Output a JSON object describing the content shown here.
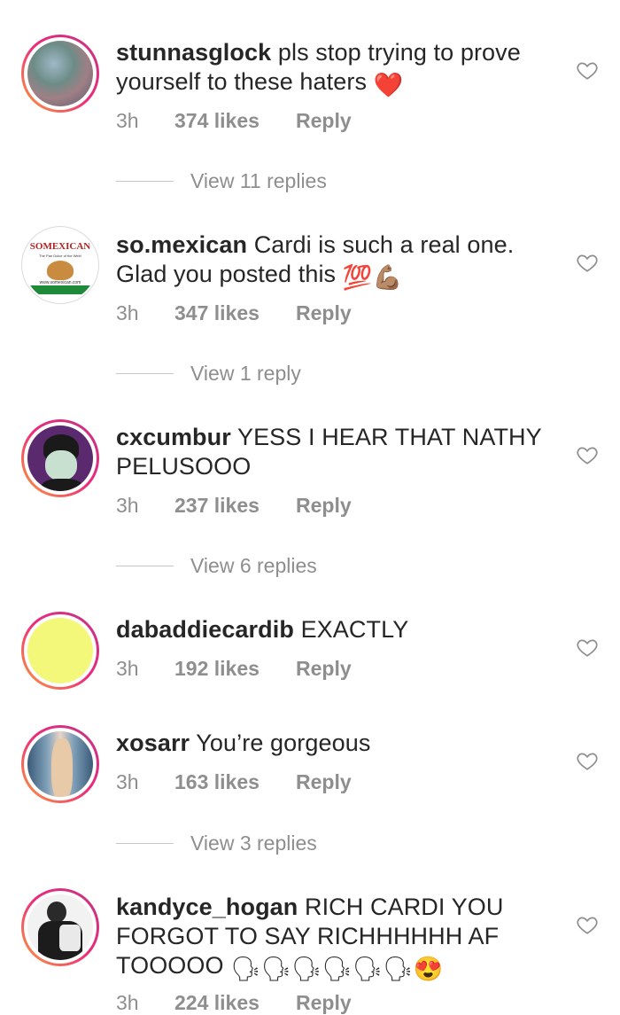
{
  "comments": [
    {
      "username": "stunnasglock",
      "text": "pls stop trying to prove yourself to these haters",
      "emoji": "❤️",
      "time": "3h",
      "likes": "374 likes",
      "reply": "Reply",
      "view_replies": "View 11 replies"
    },
    {
      "username": "so.mexican",
      "text": "Cardi is such a real one. Glad you posted this",
      "emoji": "💯💪🏽",
      "time": "3h",
      "likes": "347 likes",
      "reply": "Reply",
      "view_replies": "View 1 reply",
      "avatar_text": "SOMEXICAN",
      "avatar_sub": "The Pan Dulce of the Web!",
      "avatar_url": "www.somexican.com"
    },
    {
      "username": "cxcumbur",
      "text": "YESS I HEAR THAT NATHY PELUSOOO",
      "time": "3h",
      "likes": "237 likes",
      "reply": "Reply",
      "view_replies": "View 6 replies"
    },
    {
      "username": "dabaddiecardib",
      "text": "EXACTLY",
      "time": "3h",
      "likes": "192 likes",
      "reply": "Reply"
    },
    {
      "username": "xosarr",
      "text": "You’re gorgeous",
      "time": "3h",
      "likes": "163 likes",
      "reply": "Reply",
      "view_replies": "View 3 replies"
    },
    {
      "username": "kandyce_hogan",
      "text": "RICH CARDI YOU FORGOT TO SAY RICHHHHHH AF TOOOOO",
      "emoji": "🗣🗣🗣🗣🗣🗣😍",
      "time": "3h",
      "likes": "224 likes",
      "reply": "Reply"
    }
  ],
  "colors": {
    "text": "#262626",
    "secondary": "#8e8e8e",
    "ring_start": "#f9a13a",
    "ring_end": "#c13584",
    "yellow_avatar": "#f3f77a",
    "emoji_heart": "#e0245e"
  },
  "icons": {
    "like": "heart-outline-icon"
  }
}
